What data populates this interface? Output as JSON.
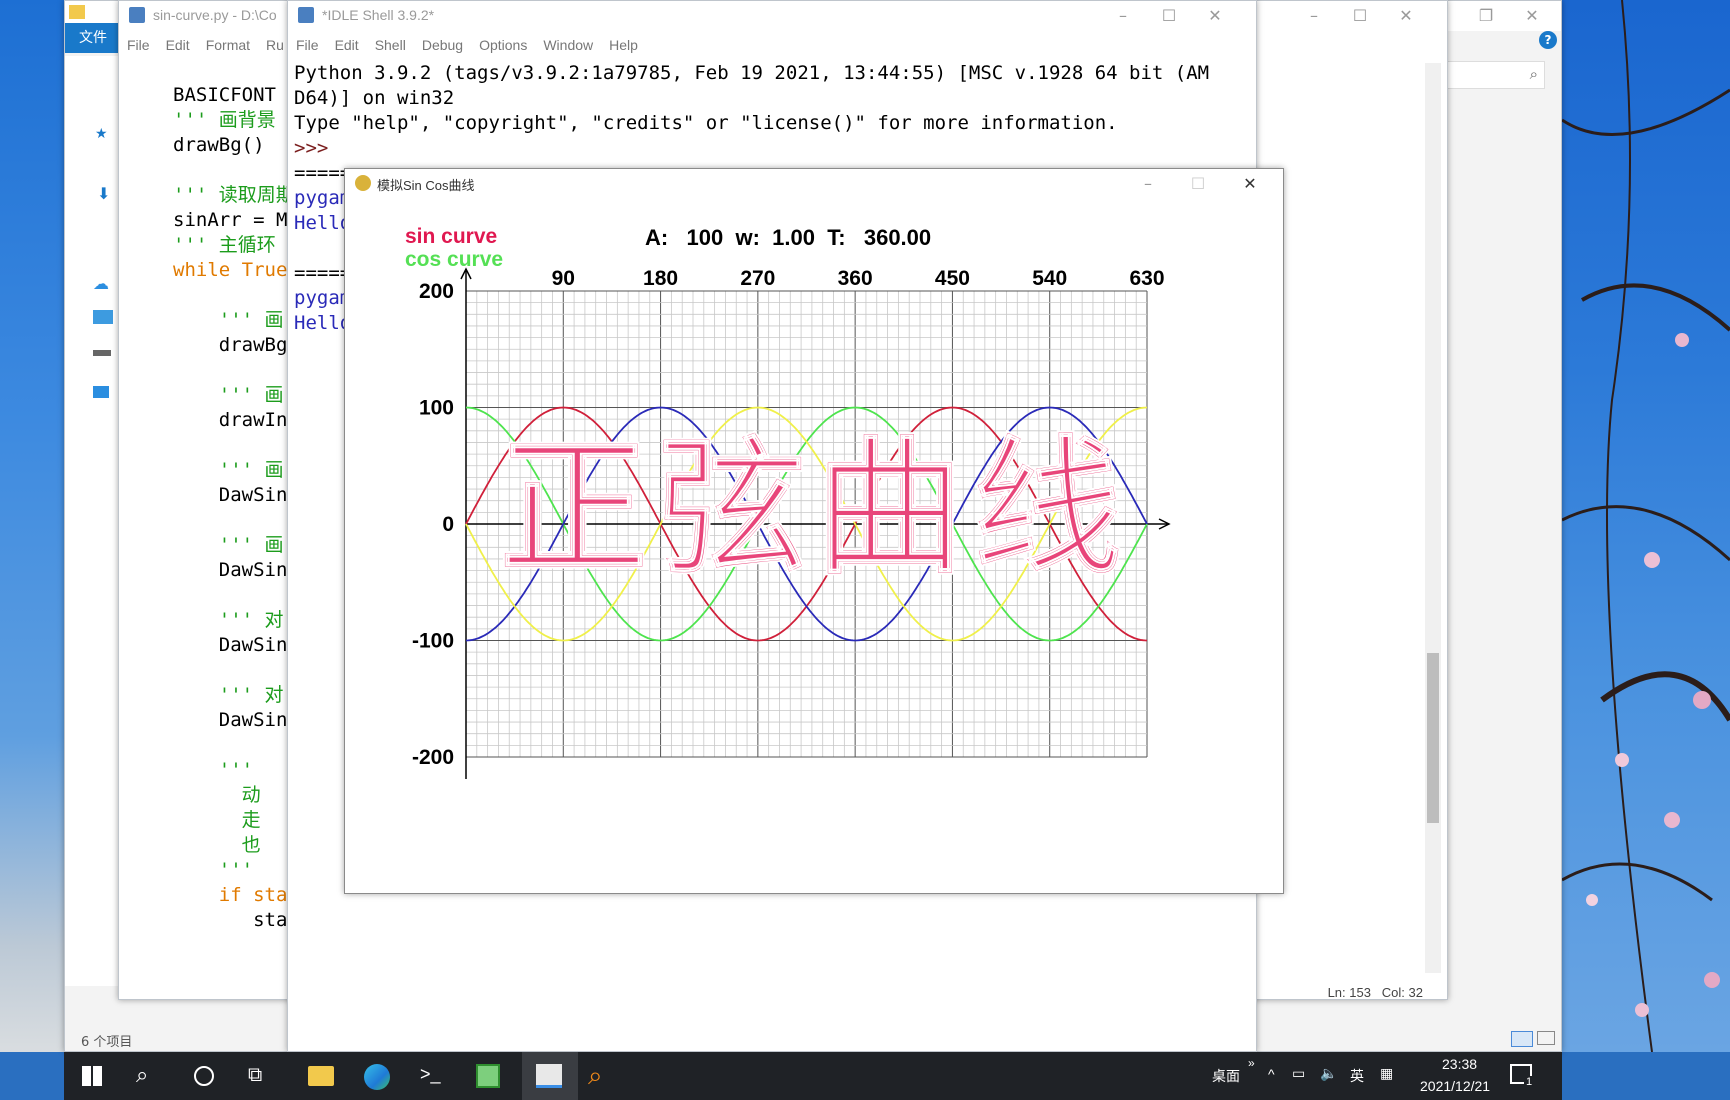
{
  "explorer": {
    "file_tab": "文件",
    "status": "6 个项目"
  },
  "editor": {
    "title": "sin-curve.py - D:\\Co",
    "menu": [
      "File",
      "Edit",
      "Format",
      "Ru"
    ],
    "code_lines": [
      {
        "cls": "",
        "text": "BASICFONT "
      },
      {
        "cls": "cm",
        "text": "''' 画背景"
      },
      {
        "cls": "",
        "text": "drawBg()"
      },
      {
        "cls": "",
        "text": ""
      },
      {
        "cls": "cm",
        "text": "''' 读取周期"
      },
      {
        "cls": "",
        "text": "sinArr = M"
      },
      {
        "cls": "cm",
        "text": "''' 主循环"
      },
      {
        "cls": "kw",
        "text": "while True"
      },
      {
        "cls": "",
        "text": ""
      },
      {
        "cls": "cm",
        "text": "    ''' 画"
      },
      {
        "cls": "",
        "text": "    drawBg"
      },
      {
        "cls": "",
        "text": ""
      },
      {
        "cls": "cm",
        "text": "    ''' 画"
      },
      {
        "cls": "",
        "text": "    drawIn"
      },
      {
        "cls": "",
        "text": ""
      },
      {
        "cls": "cm",
        "text": "    ''' 画"
      },
      {
        "cls": "",
        "text": "    DawSin"
      },
      {
        "cls": "",
        "text": ""
      },
      {
        "cls": "cm",
        "text": "    ''' 画"
      },
      {
        "cls": "",
        "text": "    DawSin"
      },
      {
        "cls": "",
        "text": ""
      },
      {
        "cls": "cm",
        "text": "    ''' 对"
      },
      {
        "cls": "",
        "text": "    DawSin"
      },
      {
        "cls": "",
        "text": ""
      },
      {
        "cls": "cm",
        "text": "    ''' 对"
      },
      {
        "cls": "",
        "text": "    DawSin"
      },
      {
        "cls": "",
        "text": ""
      },
      {
        "cls": "cm",
        "text": "    '''"
      },
      {
        "cls": "cm",
        "text": "      动"
      },
      {
        "cls": "cm",
        "text": "      走"
      },
      {
        "cls": "cm",
        "text": "      也"
      },
      {
        "cls": "cm",
        "text": "    '''"
      },
      {
        "cls": "kw",
        "text": "    if sta"
      },
      {
        "cls": "",
        "text": "       sta"
      }
    ],
    "status_ln": "Ln: 153",
    "status_col": "Col: 32"
  },
  "shell": {
    "title": "*IDLE Shell 3.9.2*",
    "menu": [
      "File",
      "Edit",
      "Shell",
      "Debug",
      "Options",
      "Window",
      "Help"
    ],
    "lines": [
      {
        "cls": "",
        "text": "Python 3.9.2 (tags/v3.9.2:1a79785, Feb 19 2021, 13:44:55) [MSC v.1928 64 bit (AM"
      },
      {
        "cls": "",
        "text": "D64)] on win32"
      },
      {
        "cls": "",
        "text": "Type \"help\", \"copyright\", \"credits\" or \"license()\" for more information."
      },
      {
        "cls": "prompt",
        "text": ">>>"
      },
      {
        "cls": "",
        "text": "====="
      },
      {
        "cls": "blue",
        "text": "pygam"
      },
      {
        "cls": "blue",
        "text": "Hello"
      },
      {
        "cls": "",
        "text": ""
      },
      {
        "cls": "",
        "text": "====="
      },
      {
        "cls": "blue",
        "text": "pygam"
      },
      {
        "cls": "blue",
        "text": "Hello"
      }
    ]
  },
  "pygame_window": {
    "title": "模拟Sin Cos曲线",
    "legend_sin": "sin curve",
    "legend_cos": "cos curve",
    "params_text": "A:   100  w:  1.00  T:   360.00",
    "overlay_text": "正弦曲线",
    "colors": {
      "sin": "#d0203a",
      "cos": "#4ee44e",
      "sin_shift": "#2a2ab8",
      "cos_shift": "#f0f04a",
      "overlay": "#e8457a"
    }
  },
  "chart_data": {
    "type": "line",
    "x_ticks": [
      90,
      180,
      270,
      360,
      450,
      540,
      630
    ],
    "y_ticks": [
      200,
      100,
      0,
      -100,
      -200
    ],
    "xlim": [
      0,
      630
    ],
    "ylim": [
      -200,
      200
    ],
    "grid": true,
    "amplitude": 100,
    "period_deg": 360,
    "series": [
      {
        "name": "sin curve",
        "color": "#d0203a",
        "function": "sin",
        "phase_deg": 0
      },
      {
        "name": "cos curve",
        "color": "#4ee44e",
        "function": "cos",
        "phase_deg": 0
      },
      {
        "color": "#2a2ab8",
        "function": "cos",
        "phase_deg": 180
      },
      {
        "color": "#f0f04a",
        "function": "sin",
        "phase_deg": 180
      }
    ]
  },
  "taskbar": {
    "ime": "英",
    "desktop_label": "桌面",
    "time": "23:38",
    "date": "2021/12/21",
    "notification_count": "1"
  }
}
